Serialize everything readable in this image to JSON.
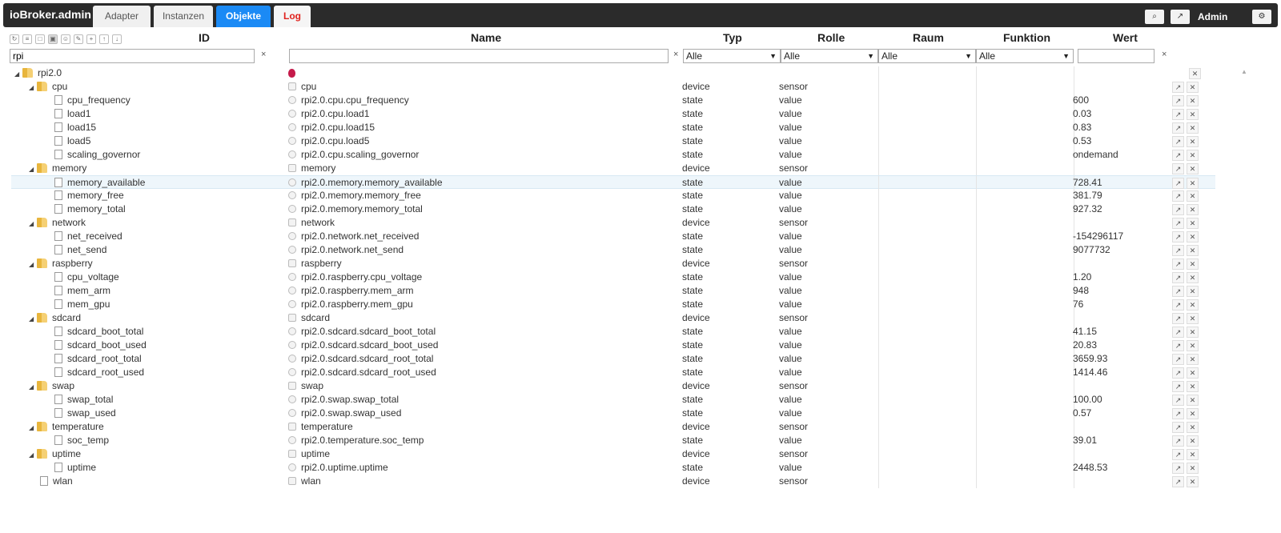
{
  "app": {
    "brand": "ioBroker.admin",
    "tabs": [
      {
        "label": "Adapter"
      },
      {
        "label": "Instanzen"
      },
      {
        "label": "Objekte"
      },
      {
        "label": "Log"
      }
    ],
    "user": "Admin",
    "icons": {
      "search": "search-icon",
      "edit": "pencil-icon",
      "settings": "gear-icon"
    }
  },
  "columns": {
    "id": "ID",
    "name": "Name",
    "type": "Typ",
    "role": "Rolle",
    "room": "Raum",
    "function": "Funktion",
    "value": "Wert"
  },
  "filters": {
    "id_value": "rpi",
    "name_value": "",
    "type_selected": "Alle",
    "role_selected": "Alle",
    "room_selected": "Alle",
    "function_selected": "Alle",
    "value_value": "",
    "clear_glyph": "×"
  },
  "accent": {
    "objekte_tab": "#1b8af5",
    "log_tab_text": "#e0221d",
    "topbar": "#2b2b2b"
  },
  "rows": [
    {
      "id": "rpi2.0",
      "name": "",
      "type": "",
      "role": "",
      "value": "",
      "kind": "folder",
      "depth": 0
    },
    {
      "id": "cpu",
      "name": "cpu",
      "type": "device",
      "role": "sensor",
      "value": "",
      "kind": "folder",
      "depth": 1
    },
    {
      "id": "cpu_frequency",
      "name": "rpi2.0.cpu.cpu_frequency",
      "type": "state",
      "role": "value",
      "value": "600",
      "kind": "file",
      "depth": 2
    },
    {
      "id": "load1",
      "name": "rpi2.0.cpu.load1",
      "type": "state",
      "role": "value",
      "value": "0.03",
      "kind": "file",
      "depth": 2
    },
    {
      "id": "load15",
      "name": "rpi2.0.cpu.load15",
      "type": "state",
      "role": "value",
      "value": "0.83",
      "kind": "file",
      "depth": 2
    },
    {
      "id": "load5",
      "name": "rpi2.0.cpu.load5",
      "type": "state",
      "role": "value",
      "value": "0.53",
      "kind": "file",
      "depth": 2
    },
    {
      "id": "scaling_governor",
      "name": "rpi2.0.cpu.scaling_governor",
      "type": "state",
      "role": "value",
      "value": "ondemand",
      "kind": "file",
      "depth": 2
    },
    {
      "id": "memory",
      "name": "memory",
      "type": "device",
      "role": "sensor",
      "value": "",
      "kind": "folder",
      "depth": 1
    },
    {
      "id": "memory_available",
      "name": "rpi2.0.memory.memory_available",
      "type": "state",
      "role": "value",
      "value": "728.41",
      "kind": "file",
      "depth": 2
    },
    {
      "id": "memory_free",
      "name": "rpi2.0.memory.memory_free",
      "type": "state",
      "role": "value",
      "value": "381.79",
      "kind": "file",
      "depth": 2
    },
    {
      "id": "memory_total",
      "name": "rpi2.0.memory.memory_total",
      "type": "state",
      "role": "value",
      "value": "927.32",
      "kind": "file",
      "depth": 2
    },
    {
      "id": "network",
      "name": "network",
      "type": "device",
      "role": "sensor",
      "value": "",
      "kind": "folder",
      "depth": 1
    },
    {
      "id": "net_received",
      "name": "rpi2.0.network.net_received",
      "type": "state",
      "role": "value",
      "value": "-154296117",
      "kind": "file",
      "depth": 2
    },
    {
      "id": "net_send",
      "name": "rpi2.0.network.net_send",
      "type": "state",
      "role": "value",
      "value": "9077732",
      "kind": "file",
      "depth": 2
    },
    {
      "id": "raspberry",
      "name": "raspberry",
      "type": "device",
      "role": "sensor",
      "value": "",
      "kind": "folder",
      "depth": 1
    },
    {
      "id": "cpu_voltage",
      "name": "rpi2.0.raspberry.cpu_voltage",
      "type": "state",
      "role": "value",
      "value": "1.20",
      "kind": "file",
      "depth": 2
    },
    {
      "id": "mem_arm",
      "name": "rpi2.0.raspberry.mem_arm",
      "type": "state",
      "role": "value",
      "value": "948",
      "kind": "file",
      "depth": 2
    },
    {
      "id": "mem_gpu",
      "name": "rpi2.0.raspberry.mem_gpu",
      "type": "state",
      "role": "value",
      "value": "76",
      "kind": "file",
      "depth": 2
    },
    {
      "id": "sdcard",
      "name": "sdcard",
      "type": "device",
      "role": "sensor",
      "value": "",
      "kind": "folder",
      "depth": 1
    },
    {
      "id": "sdcard_boot_total",
      "name": "rpi2.0.sdcard.sdcard_boot_total",
      "type": "state",
      "role": "value",
      "value": "41.15",
      "kind": "file",
      "depth": 2
    },
    {
      "id": "sdcard_boot_used",
      "name": "rpi2.0.sdcard.sdcard_boot_used",
      "type": "state",
      "role": "value",
      "value": "20.83",
      "kind": "file",
      "depth": 2
    },
    {
      "id": "sdcard_root_total",
      "name": "rpi2.0.sdcard.sdcard_root_total",
      "type": "state",
      "role": "value",
      "value": "3659.93",
      "kind": "file",
      "depth": 2
    },
    {
      "id": "sdcard_root_used",
      "name": "rpi2.0.sdcard.sdcard_root_used",
      "type": "state",
      "role": "value",
      "value": "1414.46",
      "kind": "file",
      "depth": 2
    },
    {
      "id": "swap",
      "name": "swap",
      "type": "device",
      "role": "sensor",
      "value": "",
      "kind": "folder",
      "depth": 1
    },
    {
      "id": "swap_total",
      "name": "rpi2.0.swap.swap_total",
      "type": "state",
      "role": "value",
      "value": "100.00",
      "kind": "file",
      "depth": 2
    },
    {
      "id": "swap_used",
      "name": "rpi2.0.swap.swap_used",
      "type": "state",
      "role": "value",
      "value": "0.57",
      "kind": "file",
      "depth": 2
    },
    {
      "id": "temperature",
      "name": "temperature",
      "type": "device",
      "role": "sensor",
      "value": "",
      "kind": "folder",
      "depth": 1
    },
    {
      "id": "soc_temp",
      "name": "rpi2.0.temperature.soc_temp",
      "type": "state",
      "role": "value",
      "value": "39.01",
      "kind": "file",
      "depth": 2
    },
    {
      "id": "uptime",
      "name": "uptime",
      "type": "device",
      "role": "sensor",
      "value": "",
      "kind": "folder",
      "depth": 1
    },
    {
      "id": "uptime",
      "name": "rpi2.0.uptime.uptime",
      "type": "state",
      "role": "value",
      "value": "2448.53",
      "kind": "file",
      "depth": 2
    },
    {
      "id": "wlan",
      "name": "wlan",
      "type": "device",
      "role": "sensor",
      "value": "",
      "kind": "file",
      "depth": 1
    }
  ]
}
